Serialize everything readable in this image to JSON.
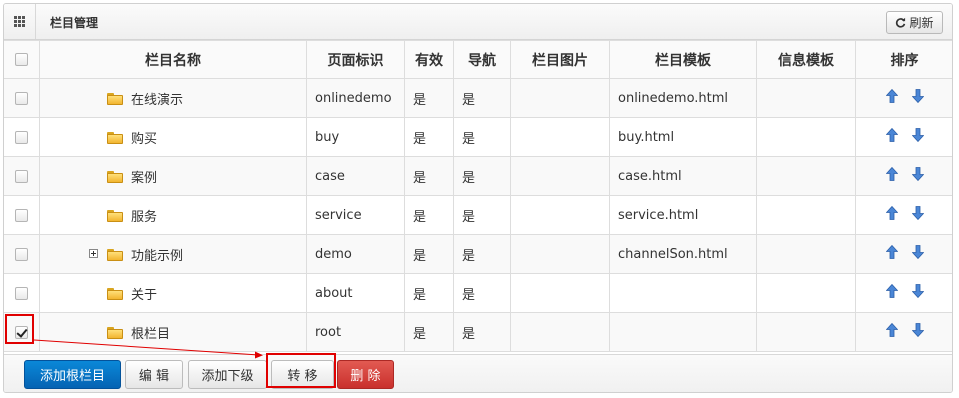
{
  "panel": {
    "title": "栏目管理",
    "refresh_label": "刷新"
  },
  "table": {
    "headers": {
      "name": "栏目名称",
      "page_id": "页面标识",
      "valid": "有效",
      "nav": "导航",
      "image": "栏目图片",
      "template": "栏目模板",
      "info_template": "信息模板",
      "sort": "排序"
    },
    "rows": [
      {
        "name": "在线演示",
        "page_id": "onlinedemo",
        "valid": "是",
        "nav": "是",
        "image": "",
        "template": "onlinedemo.html",
        "info_template": "",
        "checked": false,
        "expandable": false
      },
      {
        "name": "购买",
        "page_id": "buy",
        "valid": "是",
        "nav": "是",
        "image": "",
        "template": "buy.html",
        "info_template": "",
        "checked": false,
        "expandable": false
      },
      {
        "name": "案例",
        "page_id": "case",
        "valid": "是",
        "nav": "是",
        "image": "",
        "template": "case.html",
        "info_template": "",
        "checked": false,
        "expandable": false
      },
      {
        "name": "服务",
        "page_id": "service",
        "valid": "是",
        "nav": "是",
        "image": "",
        "template": "service.html",
        "info_template": "",
        "checked": false,
        "expandable": false
      },
      {
        "name": "功能示例",
        "page_id": "demo",
        "valid": "是",
        "nav": "是",
        "image": "",
        "template": "channelSon.html",
        "info_template": "",
        "checked": false,
        "expandable": true
      },
      {
        "name": "关于",
        "page_id": "about",
        "valid": "是",
        "nav": "是",
        "image": "",
        "template": "",
        "info_template": "",
        "checked": false,
        "expandable": false
      },
      {
        "name": "根栏目",
        "page_id": "root",
        "valid": "是",
        "nav": "是",
        "image": "",
        "template": "",
        "info_template": "",
        "checked": true,
        "expandable": false
      }
    ]
  },
  "toolbar": {
    "add_root_label": "添加根栏目",
    "edit_label": "编 辑",
    "add_child_label": "添加下级",
    "move_label": "转 移",
    "delete_label": "删 除"
  },
  "colors": {
    "primary": "#0563b3",
    "danger": "#c9302c",
    "arrow_blue": "#3a78c8",
    "annotation_red": "#e00000"
  },
  "icons": {
    "header": "grid-icon",
    "refresh": "refresh-icon",
    "folder": "folder-icon",
    "expand": "plus-square-icon",
    "move_up": "arrow-up-icon",
    "move_down": "arrow-down-icon"
  }
}
